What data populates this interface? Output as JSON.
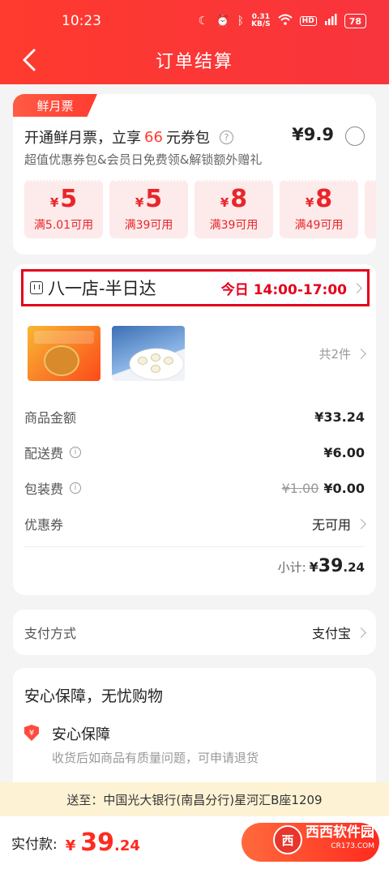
{
  "status_bar": {
    "time": "10:23",
    "net_speed": "0.31",
    "net_unit": "KB/S",
    "battery": "78"
  },
  "nav": {
    "title": "订单结算"
  },
  "member": {
    "tag": "鲜月票",
    "title_prefix": "开通鲜月票，立享",
    "title_highlight": "66",
    "title_suffix": "元券包",
    "price": "¥9.9",
    "subtitle": "超值优惠券包&会员日免费领&解锁额外赠礼",
    "coupons": [
      {
        "currency": "¥",
        "amount": "5",
        "condition": "满5.01可用"
      },
      {
        "currency": "¥",
        "amount": "5",
        "condition": "满39可用"
      },
      {
        "currency": "¥",
        "amount": "8",
        "condition": "满39可用"
      },
      {
        "currency": "¥",
        "amount": "8",
        "condition": "满49可用"
      }
    ]
  },
  "order": {
    "store_name": "八一店-半日达",
    "delivery_time": "今日 14:00-17:00",
    "item_count": "共2件",
    "goods_label": "商品金额",
    "goods_amount": "¥33.24",
    "shipping_label": "配送费",
    "shipping_amount": "¥6.00",
    "packing_label": "包装费",
    "packing_original": "¥1.00",
    "packing_amount": "¥0.00",
    "coupon_label": "优惠券",
    "coupon_value": "无可用",
    "subtotal_label": "小计:",
    "subtotal_currency": "¥",
    "subtotal_int": "39",
    "subtotal_dec": ".24"
  },
  "payment": {
    "label": "支付方式",
    "value": "支付宝"
  },
  "guarantee": {
    "title": "安心保障，无忧购物",
    "shield_glyph": "¥",
    "name": "安心保障",
    "desc": "收货后如商品有质量问题，可申请退货"
  },
  "address": {
    "text": "送至：中国光大银行(南昌分行)星河汇B座1209"
  },
  "footer": {
    "total_label": "实付款:",
    "currency": "¥",
    "total_int": "39",
    "total_dec": ".24"
  },
  "watermark": {
    "logo": "西",
    "name": "西西软件园",
    "url": "CR173.COM"
  },
  "colors": {
    "brand_red": "#ff3a2e",
    "highlight_border": "#e3001b",
    "coupon_bg": "#fdeaea",
    "address_bg": "#fdf3d4"
  }
}
